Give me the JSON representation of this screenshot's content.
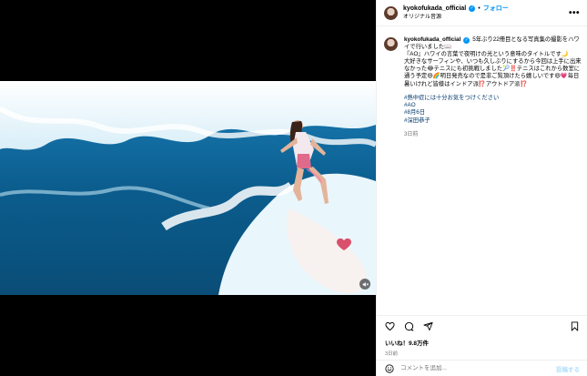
{
  "colors": {
    "link": "#00376b",
    "accent": "#0095f6",
    "muted": "#737373",
    "divider": "#efefef"
  },
  "media": {
    "mute_icon": "speaker-muted-icon"
  },
  "header": {
    "username": "kyokofukada_official",
    "follow_label": "フォロー",
    "separator": "•",
    "subtitle": "オリジナル音源",
    "more_icon": "more-horizontal-icon"
  },
  "caption": {
    "username": "kyokofukada_official",
    "lines": [
      "5年ぶり22冊目となる写真集の撮影をハワイで行いました📖",
      "『AO』ハワイの言葉で夜明けの光という意味のタイトルです🌙",
      "大好きなサーフィンや、いつも久しぶりにするから今回は上手に出来なかった😂テニスにも初挑戦しました🎾‼️テニスはこれから数室に通う予定😆🌈明日発売なので是非ご覧頂けたら嬉しいです😆💗毎日暑いけれど皆様はインドア派⁉️アウトドア派⁉️"
    ],
    "hashtags": [
      "#熱中症には十分お気をつけください",
      "#AO",
      "#8月6日",
      "#深田恭子"
    ],
    "time": "3日前"
  },
  "actions": {
    "like_icon": "heart-icon",
    "comment_icon": "comment-icon",
    "share_icon": "share-icon",
    "save_icon": "bookmark-icon"
  },
  "likes": "いいね！9.8万件",
  "post_time": "3日前",
  "comment": {
    "emoji_icon": "emoji-icon",
    "placeholder": "コメントを追加...",
    "post_label": "投稿する"
  }
}
